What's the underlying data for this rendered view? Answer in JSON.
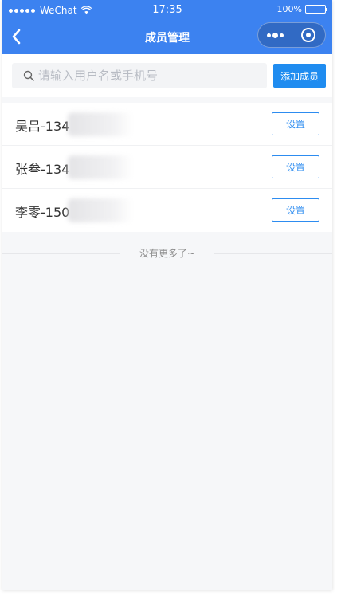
{
  "status_bar": {
    "carrier": "WeChat",
    "time": "17:35",
    "battery": "100%"
  },
  "nav": {
    "title": "成员管理"
  },
  "search": {
    "placeholder": "请输入用户名或手机号",
    "value": "",
    "add_label": "添加成员"
  },
  "members": [
    {
      "name": "吴吕-134",
      "settings_label": "设置"
    },
    {
      "name": "张叁-134",
      "settings_label": "设置"
    },
    {
      "name": "李零-150",
      "settings_label": "设置"
    }
  ],
  "footer": {
    "no_more": "没有更多了~"
  },
  "colors": {
    "brand": "#3c82f0",
    "accent_button": "#1f8cf0",
    "outline_button": "#2d8cf0"
  },
  "icons": {
    "back": "back-chevron-icon",
    "search": "search-icon",
    "more": "more-dots-icon",
    "close": "target-circle-icon",
    "wifi": "wifi-icon",
    "battery": "battery-icon"
  }
}
